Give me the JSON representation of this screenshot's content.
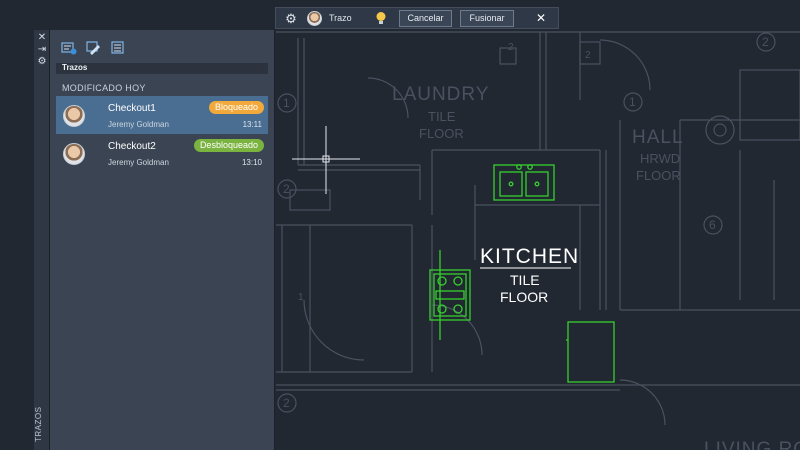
{
  "toolbar": {
    "label": "Trazo",
    "cancel_label": "Cancelar",
    "merge_label": "Fusionar",
    "close_symbol": "✕",
    "gear_icon": "gear-icon",
    "bulb_icon": "lightbulb-icon"
  },
  "strip": {
    "close_symbol": "✕",
    "pin_symbol": "⇥",
    "settings_symbol": "⚙",
    "label": "TRAZOS"
  },
  "palette": {
    "title": "Trazos",
    "section": "MODIFICADO HOY",
    "tools": [
      "new-trace-icon",
      "trace-edit-icon",
      "trace-list-icon"
    ],
    "items": [
      {
        "name": "Checkout1",
        "user": "Jeremy Goldman",
        "time": "13:11",
        "status": "Bloqueado",
        "selected": true
      },
      {
        "name": "Checkout2",
        "user": "Jeremy Goldman",
        "time": "13:10",
        "status": "Desbloqueado",
        "selected": false
      }
    ]
  },
  "drawing": {
    "rooms": [
      {
        "name": "LAUNDRY",
        "floor1": "TILE",
        "floor2": "FLOOR"
      },
      {
        "name": "KITCHEN",
        "floor1": "TILE",
        "floor2": "FLOOR"
      },
      {
        "name": "HALL",
        "floor1": "HRWD",
        "floor2": "FLOOR"
      },
      {
        "name": "LIVING RO",
        "floor1": "",
        "floor2": ""
      }
    ],
    "tags": [
      "2",
      "1",
      "2",
      "2",
      "2",
      "1",
      "6",
      "2",
      "1"
    ]
  },
  "colors": {
    "canvas": "#222831",
    "linework": "#4a5160",
    "highlight": "#36d02e",
    "selected_row": "#4a6e92",
    "badge_locked": "#f2a93b",
    "badge_unlocked": "#7ab340"
  }
}
